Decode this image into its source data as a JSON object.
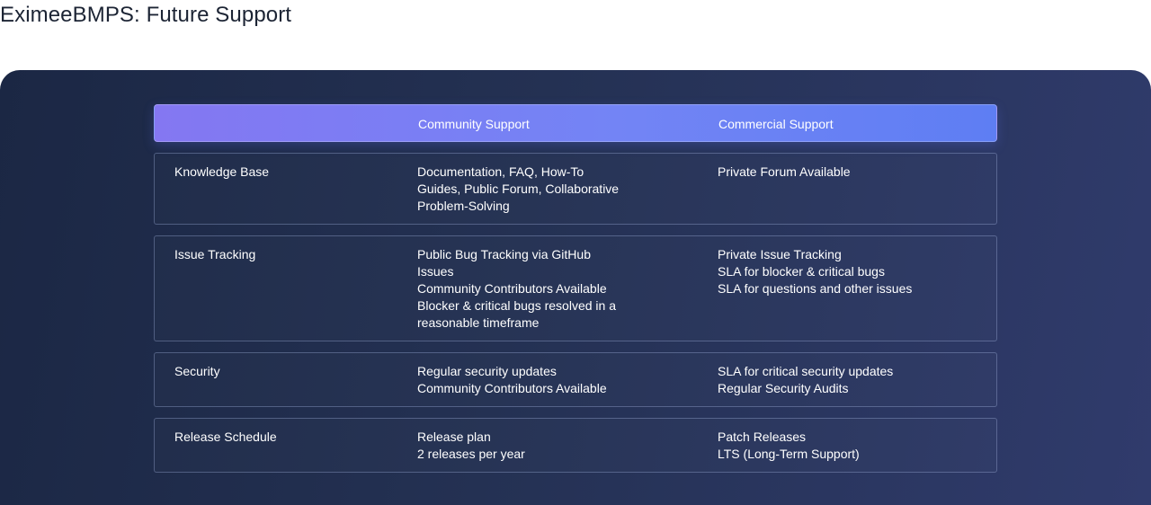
{
  "page": {
    "title": "EximeeBMPS: Future Support"
  },
  "table": {
    "headers": {
      "feature": "",
      "community": "Community Support",
      "commercial": "Commercial Support"
    },
    "rows": [
      {
        "feature": "Knowledge Base",
        "community": [
          "Documentation, FAQ, How-To",
          "Guides, Public Forum, Collaborative",
          "Problem-Solving"
        ],
        "commercial": [
          "Private Forum Available"
        ]
      },
      {
        "feature": "Issue Tracking",
        "community": [
          "Public Bug Tracking via GitHub",
          "Issues",
          "Community Contributors Available",
          "Blocker & critical bugs resolved in a",
          "reasonable timeframe"
        ],
        "commercial": [
          "Private Issue Tracking",
          "SLA for blocker & critical bugs",
          "SLA for questions and other issues"
        ]
      },
      {
        "feature": "Security",
        "community": [
          "Regular security updates",
          "Community Contributors Available"
        ],
        "commercial": [
          "SLA for critical security updates",
          "Regular Security Audits"
        ]
      },
      {
        "feature": "Release Schedule",
        "community": [
          "Release plan",
          "2 releases per year"
        ],
        "commercial": [
          "Patch Releases",
          "LTS (Long-Term Support)"
        ]
      }
    ]
  },
  "colors": {
    "title_text": "#1c2434",
    "panel_start": "#1b2744",
    "panel_end": "#303b6c",
    "header_start": "#8477f2",
    "header_end": "#5e7ef3",
    "row_border": "#aab9e6",
    "cell_text": "#ffffff"
  }
}
